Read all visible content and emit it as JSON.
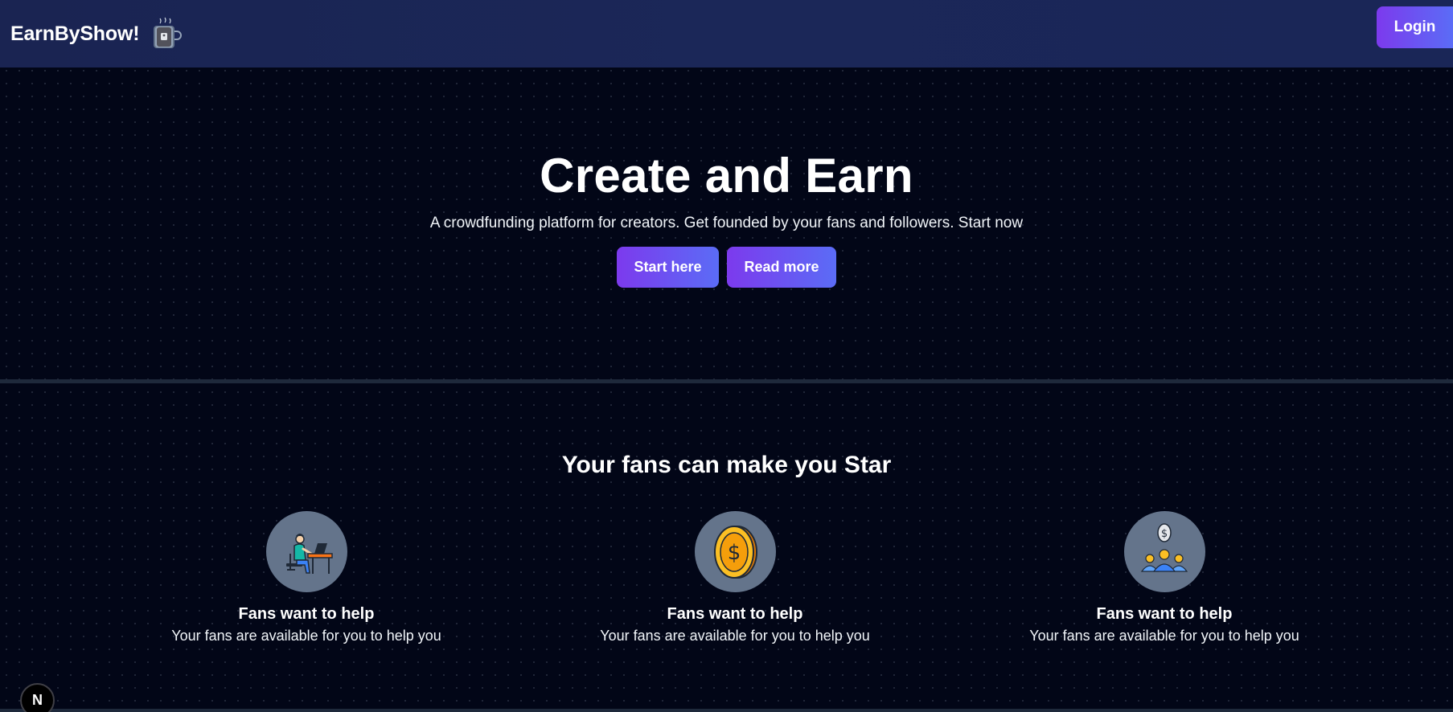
{
  "navbar": {
    "brand": "EarnByShow!",
    "logo_icon": "coffee-mug-icon",
    "login_label": "Login"
  },
  "hero": {
    "title": "Create and Earn",
    "subtitle": "A crowdfunding platform for creators. Get founded by your fans and followers. Start now",
    "buttons": {
      "start_label": "Start here",
      "read_label": "Read more"
    }
  },
  "features": {
    "heading": "Your fans can make you Star",
    "items": [
      {
        "icon": "person-at-desk-icon",
        "title": "Fans want to help",
        "text": "Your fans are available for you to help you"
      },
      {
        "icon": "gold-coin-icon",
        "title": "Fans want to help",
        "text": "Your fans are available for you to help you"
      },
      {
        "icon": "group-funding-icon",
        "title": "Fans want to help",
        "text": "Your fans are available for you to help you"
      }
    ]
  },
  "dev_badge": {
    "label": "N"
  },
  "colors": {
    "background": "#020617",
    "navbar": "#1b2758",
    "accent_start": "#7c3aed",
    "accent_end": "#5b6cf6",
    "icon_circle": "#64748b"
  }
}
